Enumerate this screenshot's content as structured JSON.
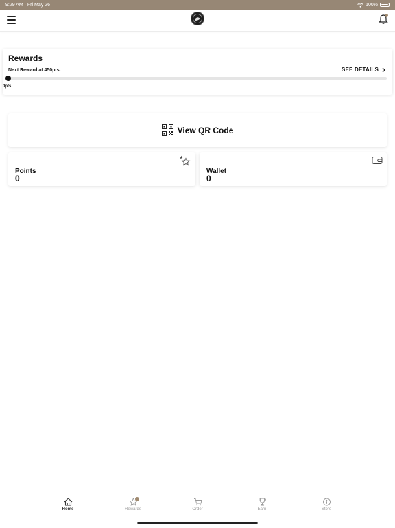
{
  "status_bar": {
    "time_date": "9:29 AM · Fri May 26",
    "battery": "100%"
  },
  "rewards": {
    "title": "Rewards",
    "next_reward": "Next Reward at 450pts.",
    "see_details": "SEE DETAILS",
    "current_points_label": "0pts.",
    "progress": 0
  },
  "qr": {
    "label": "View QR Code"
  },
  "points_card": {
    "title": "Points",
    "value": "0"
  },
  "wallet_card": {
    "title": "Wallet",
    "value": "0"
  },
  "tabs": [
    {
      "label": "Home",
      "icon": "home-icon"
    },
    {
      "label": "Rewards",
      "icon": "star-icon"
    },
    {
      "label": "Order",
      "icon": "cart-icon"
    },
    {
      "label": "Earn",
      "icon": "trophy-icon"
    },
    {
      "label": "Store",
      "icon": "info-icon"
    }
  ],
  "colors": {
    "status_bar": "#978775",
    "accent": "#a08a70",
    "progress_track": "#e5e5e5"
  }
}
